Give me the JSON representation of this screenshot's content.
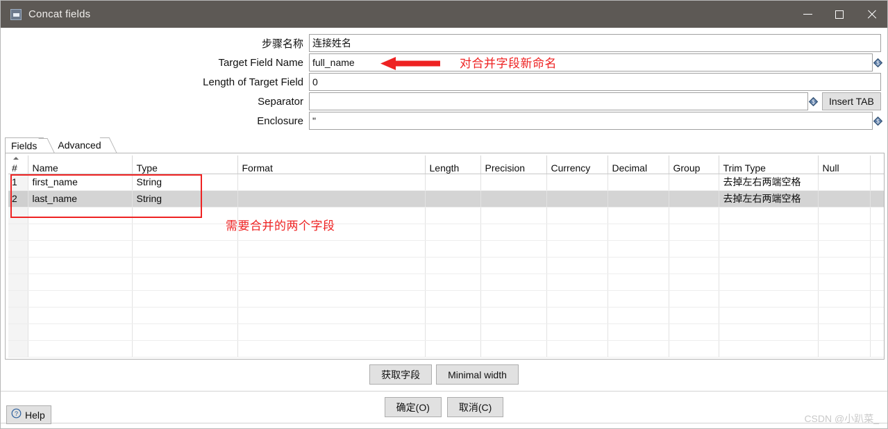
{
  "window": {
    "title": "Concat fields",
    "icon": "step-icon",
    "controls": {
      "minimize": "minimize-icon",
      "maximize": "maximize-icon",
      "close": "close-icon"
    }
  },
  "form": {
    "rows": [
      {
        "label": "步骤名称",
        "value": "连接姓名",
        "has_variable_icon": false,
        "has_insert_tab": false
      },
      {
        "label": "Target Field Name",
        "value": "full_name",
        "has_variable_icon": true,
        "has_insert_tab": false
      },
      {
        "label": "Length of Target Field",
        "value": "0",
        "has_variable_icon": false,
        "has_insert_tab": false
      },
      {
        "label": "Separator",
        "value": "",
        "has_variable_icon": true,
        "has_insert_tab": true
      },
      {
        "label": "Enclosure",
        "value": "\"",
        "has_variable_icon": true,
        "has_insert_tab": false
      }
    ],
    "insert_tab_label": "Insert TAB"
  },
  "annotations": [
    {
      "id": "target-field-name-note",
      "text": "对合并字段新命名",
      "color": "#ee2222",
      "shape": "arrow-left"
    },
    {
      "id": "fields-note",
      "text": "需要合并的两个字段",
      "color": "#ee2222",
      "shape": "box"
    }
  ],
  "tabs": [
    {
      "label": "Fields",
      "selected": true
    },
    {
      "label": "Advanced",
      "selected": false
    }
  ],
  "table": {
    "columns": [
      "#",
      "Name",
      "Type",
      "Format",
      "Length",
      "Precision",
      "Currency",
      "Decimal",
      "Group",
      "Trim Type",
      "Null",
      ""
    ],
    "sort_indicator_column": "#",
    "rows": [
      {
        "selected": false,
        "cells": [
          "1",
          "first_name",
          "String",
          "",
          "",
          "",
          "",
          "",
          "",
          "去掉左右两端空格",
          "",
          ""
        ]
      },
      {
        "selected": true,
        "cells": [
          "2",
          "last_name",
          "String",
          "",
          "",
          "",
          "",
          "",
          "",
          "去掉左右两端空格",
          "",
          ""
        ]
      }
    ],
    "empty_row_count": 9
  },
  "buttons": {
    "get_fields": "获取字段",
    "minimal_width": "Minimal width",
    "ok": "确定(O)",
    "cancel": "取消(C)",
    "help": "Help",
    "help_icon": "question-circle-icon"
  },
  "watermark": "CSDN @小趴菜_",
  "colors": {
    "titlebar": "#5d5955",
    "accent_red": "#ee2222",
    "selected_row": "#d4d4d4",
    "button_face": "#e1e1e1",
    "variable_icon": "#5a7ba6"
  }
}
